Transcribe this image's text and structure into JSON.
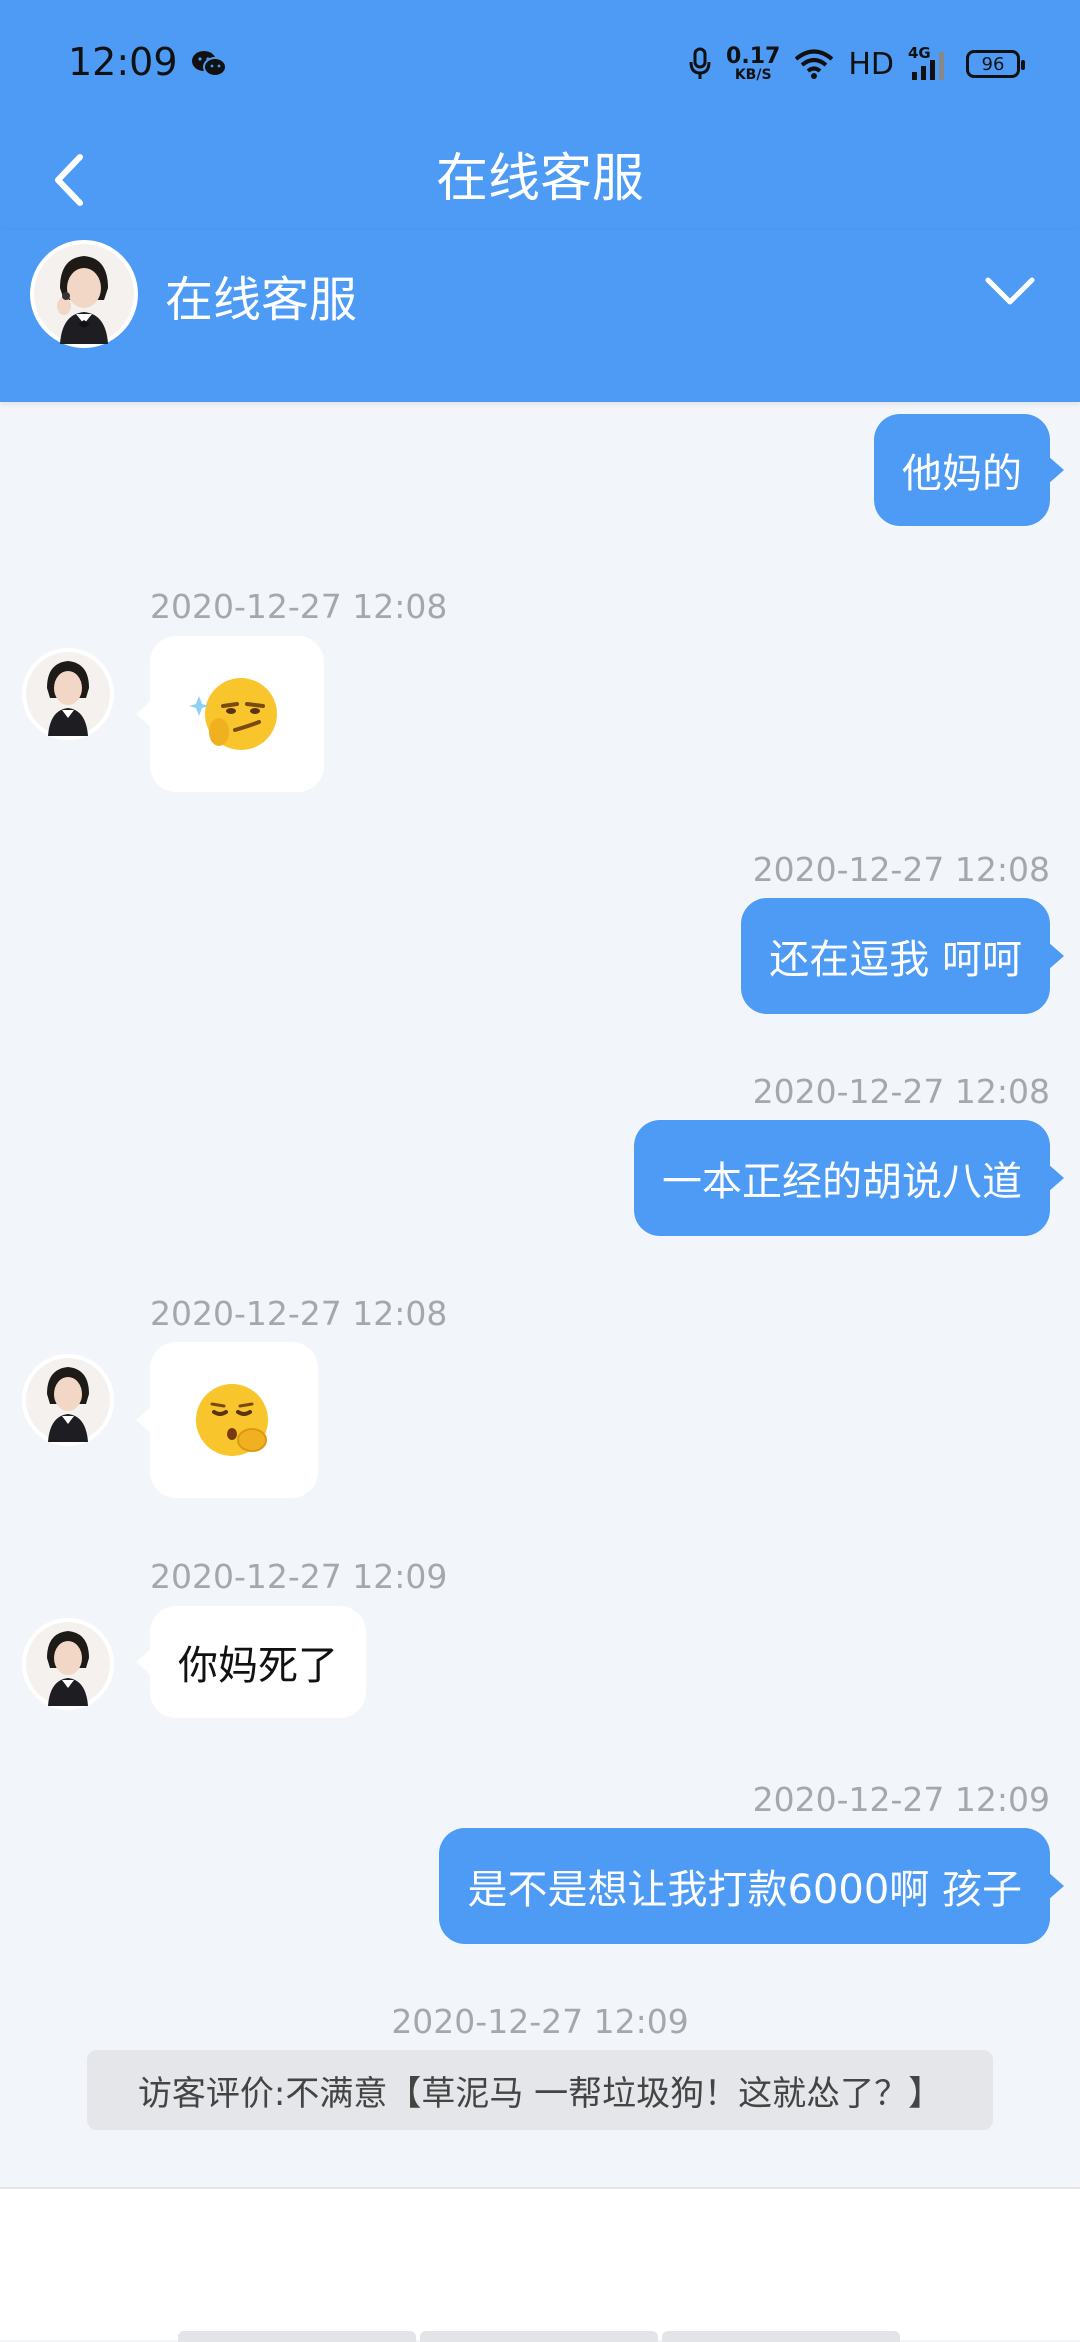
{
  "status_bar": {
    "time": "12:09",
    "net_speed_value": "0.17",
    "net_speed_unit": "KB/S",
    "hd": "HD",
    "signal_type": "4G",
    "battery": "96"
  },
  "header": {
    "title": "在线客服"
  },
  "agent": {
    "name": "在线客服"
  },
  "messages": [
    {
      "direction": "out",
      "text": "他妈的"
    },
    {
      "direction": "in",
      "timestamp": "2020-12-27 12:08",
      "emoji": "smirk-emoji"
    },
    {
      "direction": "out",
      "timestamp": "2020-12-27 12:08",
      "text": "还在逗我 呵呵"
    },
    {
      "direction": "out",
      "timestamp": "2020-12-27 12:08",
      "text": "一本正经的胡说八道"
    },
    {
      "direction": "in",
      "timestamp": "2020-12-27 12:08",
      "emoji": "shush-emoji"
    },
    {
      "direction": "in",
      "timestamp": "2020-12-27 12:09",
      "text": "你妈死了"
    },
    {
      "direction": "out",
      "timestamp": "2020-12-27 12:09",
      "text": "是不是想让我打款6000啊 孩子"
    }
  ],
  "rating": {
    "timestamp": "2020-12-27 12:09",
    "text": "访客评价:不满意【草泥马 一帮垃圾狗！这就怂了？】"
  },
  "colors": {
    "accent": "#4d9bf5",
    "background": "#f2f5f9",
    "timestamp": "#a4a8ae"
  }
}
